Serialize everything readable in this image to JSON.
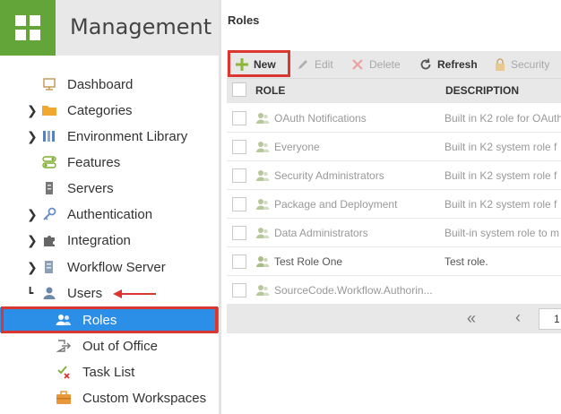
{
  "app": {
    "title": "Management"
  },
  "sidebar": {
    "items": [
      {
        "label": "Dashboard",
        "icon": "dashboard-icon",
        "expandable": false
      },
      {
        "label": "Categories",
        "icon": "folder-icon",
        "expandable": true
      },
      {
        "label": "Environment Library",
        "icon": "library-icon",
        "expandable": true
      },
      {
        "label": "Features",
        "icon": "toggle-icon",
        "expandable": false
      },
      {
        "label": "Servers",
        "icon": "server-icon",
        "expandable": false
      },
      {
        "label": "Authentication",
        "icon": "key-icon",
        "expandable": true
      },
      {
        "label": "Integration",
        "icon": "puzzle-icon",
        "expandable": true
      },
      {
        "label": "Workflow Server",
        "icon": "workflow-server-icon",
        "expandable": true
      },
      {
        "label": "Users",
        "icon": "user-icon",
        "expandable": true
      }
    ],
    "children": [
      {
        "label": "Roles",
        "icon": "roles-icon",
        "selected": true
      },
      {
        "label": "Out of Office",
        "icon": "out-of-office-icon",
        "selected": false
      },
      {
        "label": "Task List",
        "icon": "task-list-icon",
        "selected": false
      },
      {
        "label": "Custom Workspaces",
        "icon": "workspace-icon",
        "selected": false
      }
    ]
  },
  "main": {
    "title": "Roles",
    "toolbar": {
      "new": "New",
      "edit": "Edit",
      "delete": "Delete",
      "refresh": "Refresh",
      "security": "Security"
    },
    "columns": {
      "role": "ROLE",
      "description": "DESCRIPTION"
    },
    "rows": [
      {
        "role": "OAuth Notifications",
        "description": "Built in K2 role for OAuth"
      },
      {
        "role": "Everyone",
        "description": "Built in K2 system role f"
      },
      {
        "role": "Security Administrators",
        "description": "Built in K2 system role f"
      },
      {
        "role": "Package and Deployment",
        "description": "Built in K2 system role f"
      },
      {
        "role": "Data Administrators",
        "description": "Built-in system role to m"
      },
      {
        "role": "Test Role One",
        "description": "Test role."
      },
      {
        "role": "SourceCode.Workflow.Authorin...",
        "description": ""
      }
    ],
    "pager": {
      "page": "1"
    }
  },
  "colors": {
    "accent_green": "#64a539",
    "selection_blue": "#2b8fe8",
    "annotation_red": "#d9372f"
  }
}
